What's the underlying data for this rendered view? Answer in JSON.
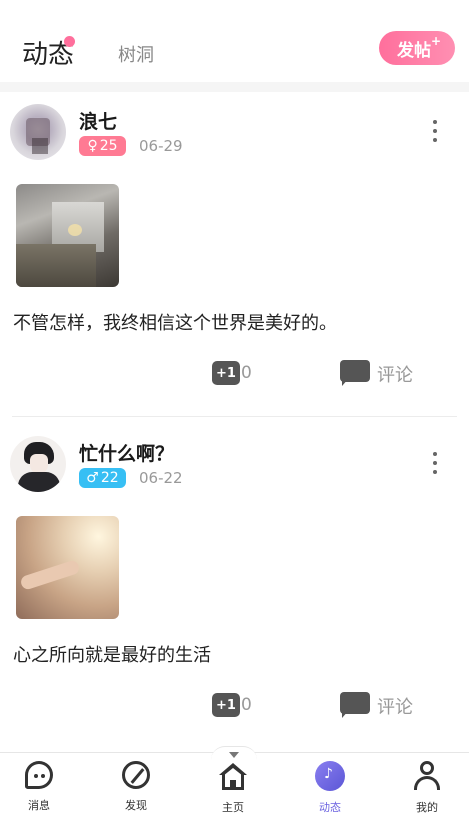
{
  "header": {
    "tab_active": "动态",
    "tab_inactive": "树洞",
    "post_button": "发帖",
    "post_button_plus": "+"
  },
  "posts": [
    {
      "username": "浪七",
      "gender_icon": "female-symbol-icon",
      "gender_symbol": "♀",
      "age": "25",
      "date": "06-29",
      "text": "不管怎样，我终相信这个世界是美好的。",
      "like_label": "+1",
      "like_count": "0",
      "comment_label": "评论"
    },
    {
      "username": "忙什么啊？",
      "gender_icon": "male-symbol-icon",
      "gender_symbol": "♂",
      "age": "22",
      "date": "06-22",
      "text": "心之所向就是最好的生活",
      "like_label": "+1",
      "like_count": "0",
      "comment_label": "评论"
    }
  ],
  "bottom_nav": [
    {
      "label": "消息",
      "icon": "chat-bubble-icon"
    },
    {
      "label": "发现",
      "icon": "compass-icon"
    },
    {
      "label": "主页",
      "icon": "home-icon"
    },
    {
      "label": "动态",
      "icon": "dongtai-icon",
      "active": true
    },
    {
      "label": "我的",
      "icon": "person-icon"
    }
  ],
  "colors": {
    "accent_pink": "#ff6f9c",
    "female_badge": "#ff7a93",
    "male_badge": "#37bff4",
    "nav_active": "#6c63e0"
  }
}
